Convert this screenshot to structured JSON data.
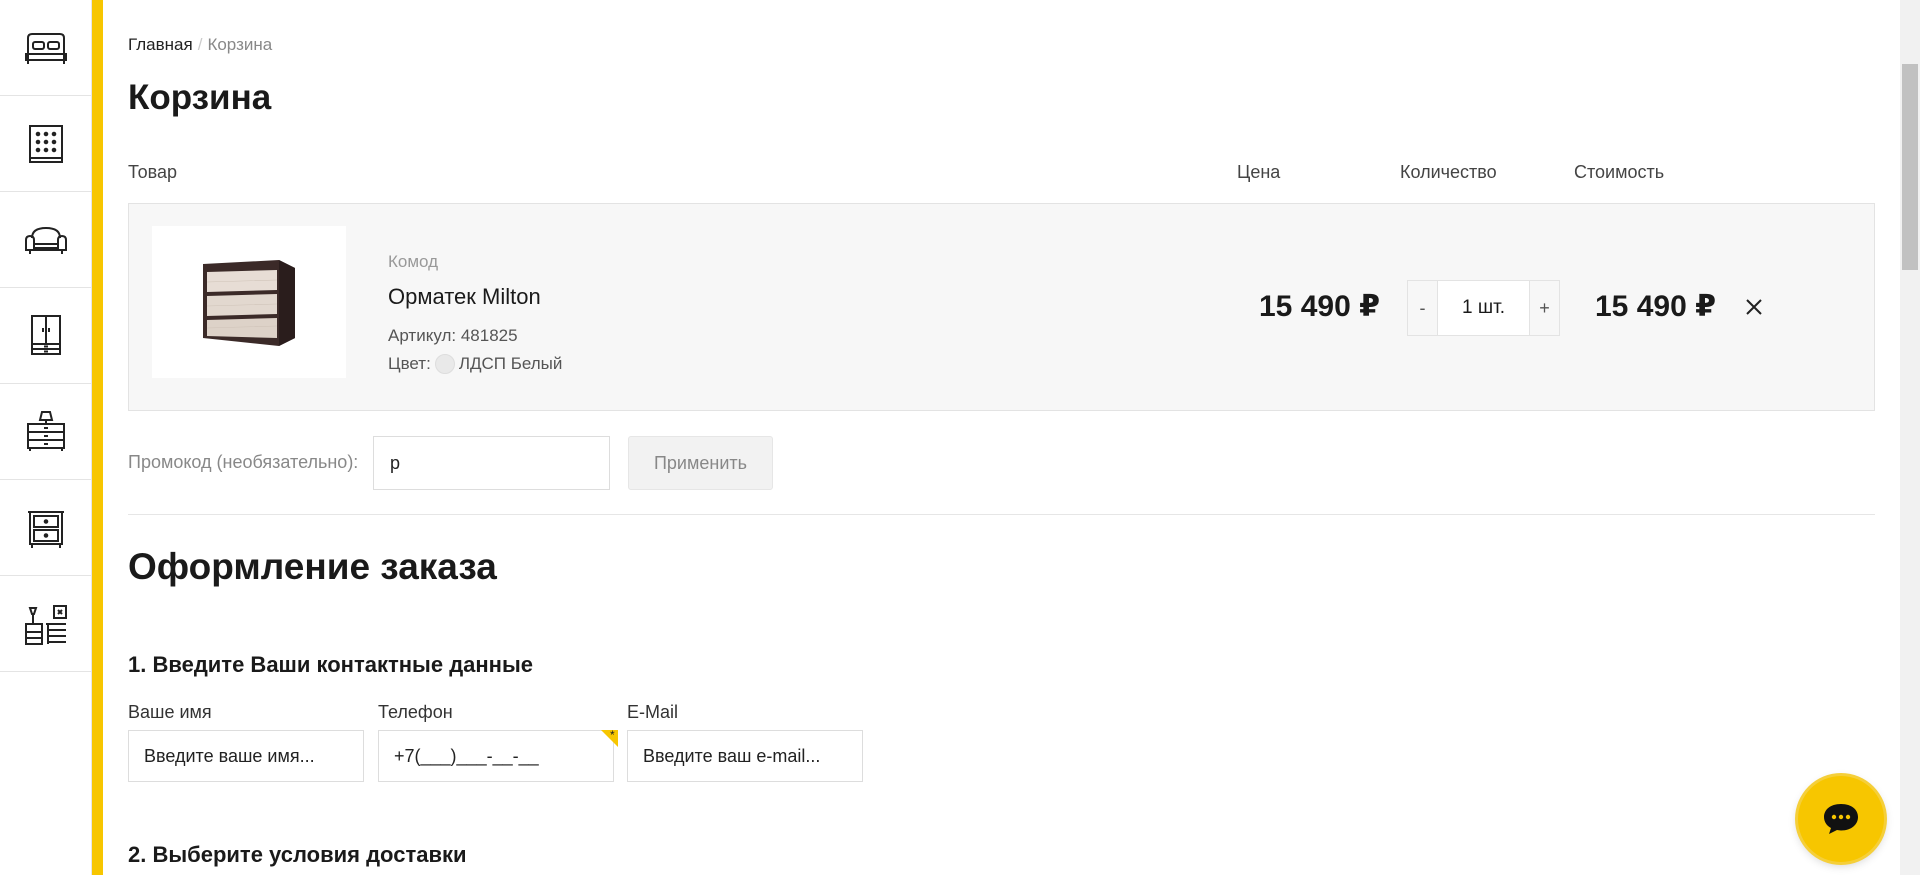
{
  "sidebar": {
    "items": [
      {
        "icon": "bed-icon"
      },
      {
        "icon": "mattress-icon"
      },
      {
        "icon": "sofa-icon"
      },
      {
        "icon": "wardrobe-icon"
      },
      {
        "icon": "dresser-lamp-icon"
      },
      {
        "icon": "nightstand-icon"
      },
      {
        "icon": "kids-room-icon"
      }
    ]
  },
  "breadcrumb": {
    "home": "Главная",
    "current": "Корзина"
  },
  "page_title": "Корзина",
  "table_headers": {
    "product": "Товар",
    "price": "Цена",
    "quantity": "Количество",
    "total": "Стоимость"
  },
  "cart_item": {
    "category": "Комод",
    "name": "Орматек Milton",
    "sku_label": "Артикул:",
    "sku": "481825",
    "color_label": "Цвет:",
    "color_value": "ЛДСП Белый",
    "price": "15 490 ₽",
    "qty_minus": "-",
    "qty_value": "1 шт.",
    "qty_plus": "+",
    "total": "15 490 ₽"
  },
  "promo": {
    "label": "Промокод (необязательно):",
    "value": "р",
    "apply_label": "Применить"
  },
  "checkout": {
    "title": "Оформление заказа",
    "step1_title": "1. Введите Ваши контактные данные",
    "name_label": "Ваше имя",
    "name_placeholder": "Введите ваше имя...",
    "phone_label": "Телефон",
    "phone_placeholder": "+7(___)___-__-__",
    "email_label": "E-Mail",
    "email_placeholder": "Введите ваш e-mail...",
    "required_mark": "*",
    "step2_title": "2. Выберите условия доставки"
  },
  "colors": {
    "accent": "#f7c600"
  },
  "chat": {
    "icon": "chat-bubble-icon"
  }
}
